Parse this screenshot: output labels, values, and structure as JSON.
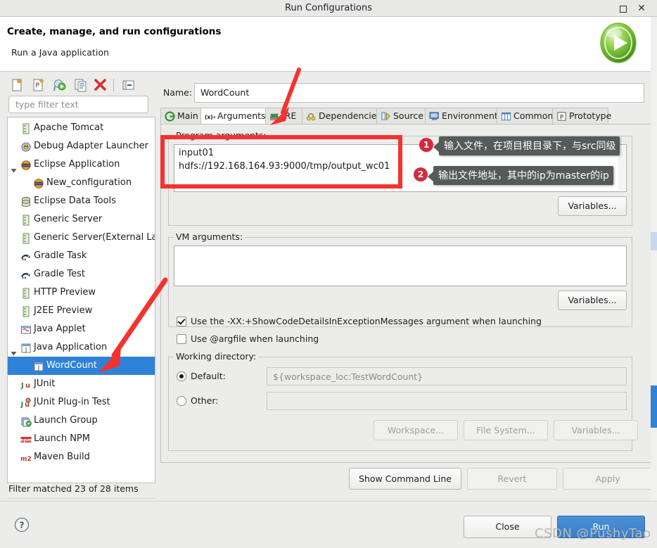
{
  "window": {
    "title": "Run Configurations",
    "maximize_label": "maximize",
    "close_label": "close"
  },
  "header": {
    "heading": "Create, manage, and run configurations",
    "subheading": "Run a Java application"
  },
  "sidebar": {
    "toolbar": [
      {
        "name": "new-launch-configuration",
        "title": "New launch configuration"
      },
      {
        "name": "new-prototype",
        "title": "New prototype"
      },
      {
        "name": "export",
        "title": "Export"
      },
      {
        "name": "duplicate",
        "title": "Duplicate"
      },
      {
        "name": "delete",
        "title": "Delete"
      },
      {
        "name": "collapse-all",
        "title": "Collapse All"
      }
    ],
    "filter_placeholder": "type filter text",
    "items": [
      {
        "label": "Apache Tomcat",
        "icon": "server-icon",
        "indent": 1,
        "twisty": "",
        "selected": false
      },
      {
        "label": "Debug Adapter Launcher",
        "icon": "bug-icon",
        "indent": 1,
        "twisty": "",
        "selected": false
      },
      {
        "label": "Eclipse Application",
        "icon": "eclipse-icon",
        "indent": 1,
        "twisty": "down",
        "selected": false
      },
      {
        "label": "New_configuration",
        "icon": "eclipse-icon",
        "indent": 2,
        "twisty": "",
        "selected": false
      },
      {
        "label": "Eclipse Data Tools",
        "icon": "database-icon",
        "indent": 1,
        "twisty": "",
        "selected": false
      },
      {
        "label": "Generic Server",
        "icon": "server-icon",
        "indent": 1,
        "twisty": "",
        "selected": false
      },
      {
        "label": "Generic Server(External La",
        "icon": "server-icon",
        "indent": 1,
        "twisty": "",
        "selected": false
      },
      {
        "label": "Gradle Task",
        "icon": "gradle-icon",
        "indent": 1,
        "twisty": "",
        "selected": false
      },
      {
        "label": "Gradle Test",
        "icon": "gradle-icon",
        "indent": 1,
        "twisty": "",
        "selected": false
      },
      {
        "label": "HTTP Preview",
        "icon": "server-icon",
        "indent": 1,
        "twisty": "",
        "selected": false
      },
      {
        "label": "J2EE Preview",
        "icon": "server-icon",
        "indent": 1,
        "twisty": "",
        "selected": false
      },
      {
        "label": "Java Applet",
        "icon": "applet-icon",
        "indent": 1,
        "twisty": "",
        "selected": false
      },
      {
        "label": "Java Application",
        "icon": "java-icon",
        "indent": 1,
        "twisty": "down",
        "selected": false
      },
      {
        "label": "WordCount",
        "icon": "java-icon",
        "indent": 2,
        "twisty": "",
        "selected": true
      },
      {
        "label": "JUnit",
        "icon": "junit-icon",
        "indent": 1,
        "twisty": "",
        "selected": false
      },
      {
        "label": "JUnit Plug-in Test",
        "icon": "junit-plugin-icon",
        "indent": 1,
        "twisty": "",
        "selected": false
      },
      {
        "label": "Launch Group",
        "icon": "launch-group-icon",
        "indent": 1,
        "twisty": "",
        "selected": false
      },
      {
        "label": "Launch NPM",
        "icon": "npm-icon",
        "indent": 1,
        "twisty": "",
        "selected": false
      },
      {
        "label": "Maven Build",
        "icon": "maven-icon",
        "indent": 1,
        "twisty": "",
        "selected": false
      }
    ],
    "filter_status": "Filter matched 23 of 28 items"
  },
  "main": {
    "name_label": "Name:",
    "name_value": "WordCount",
    "tabs": [
      {
        "label": "Main",
        "icon": "main-icon",
        "active": false
      },
      {
        "label": "Arguments",
        "icon": "arguments-icon",
        "active": true
      },
      {
        "label": "JRE",
        "icon": "jre-icon",
        "active": false
      },
      {
        "label": "Dependencies",
        "icon": "dependencies-icon",
        "active": false
      },
      {
        "label": "Source",
        "icon": "source-icon",
        "active": false
      },
      {
        "label": "Environment",
        "icon": "environment-icon",
        "active": false
      },
      {
        "label": "Common",
        "icon": "common-icon",
        "active": false
      },
      {
        "label": "Prototype",
        "icon": "prototype-icon",
        "active": false
      }
    ],
    "program_arguments": {
      "label": "Program arguments:",
      "line1": "input01",
      "line2": "hdfs://192.168.164.93:9000/tmp/output_wc01",
      "variables_button": "Variables..."
    },
    "vm_arguments": {
      "label": "VM arguments:",
      "value": "",
      "variables_button": "Variables..."
    },
    "checkboxes": [
      {
        "label": "Use the -XX:+ShowCodeDetailsInExceptionMessages argument when launching",
        "checked": true
      },
      {
        "label": "Use @argfile when launching",
        "checked": false
      }
    ],
    "working_directory": {
      "label": "Working directory:",
      "default_label": "Default:",
      "default_value": "${workspace_loc:TestWordCount}",
      "default_selected": true,
      "other_label": "Other:",
      "other_value": "",
      "other_selected": false,
      "workspace_button": "Workspace...",
      "filesystem_button": "File System...",
      "variables_button": "Variables..."
    },
    "action_buttons": {
      "show_command_line": "Show Command Line",
      "revert": "Revert",
      "apply": "Apply"
    }
  },
  "footer": {
    "help_label": "?",
    "close_button": "Close",
    "run_button": "Run"
  },
  "annotations": {
    "callout1_number": "1",
    "callout1_text": "输入文件，在项目根目录下，与src同级",
    "callout2_number": "2",
    "callout2_text": "输出文件地址，其中的ip为master的ip",
    "highlight_color": "#f5322e",
    "arrow_color": "#f5322e"
  },
  "watermark": "CSDN @PushyTao"
}
